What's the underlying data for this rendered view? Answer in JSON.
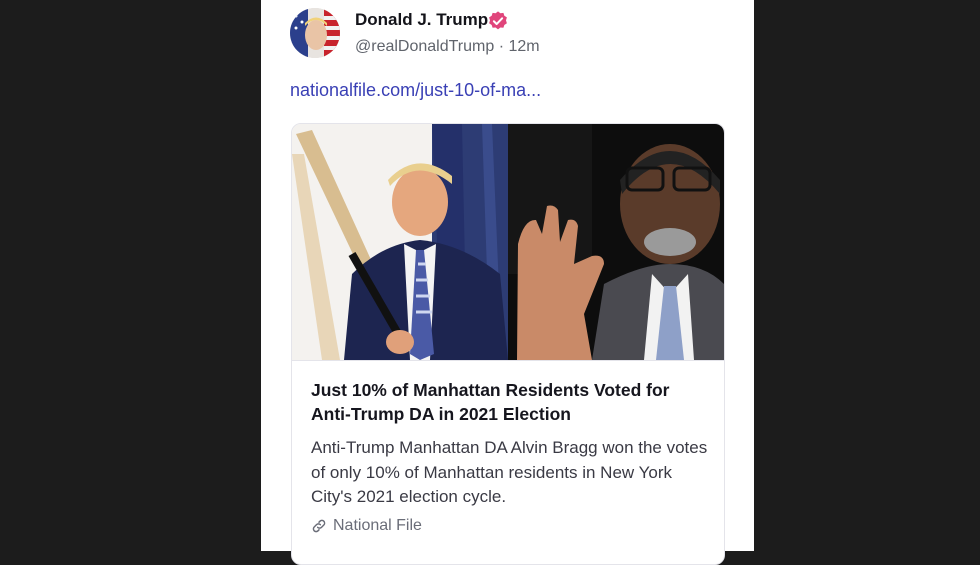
{
  "post": {
    "author_name": "Donald J. Trump",
    "handle": "@realDonaldTrump",
    "separator": "·",
    "time_ago": "12m",
    "link_text": "nationalfile.com/just-10-of-ma..."
  },
  "card": {
    "title": "Just 10% of Manhattan Residents Voted for Anti-Trump DA in 2021 Election",
    "description": "Anti-Trump Manhattan DA Alvin Bragg won the votes of only 10% of Manhattan residents in New York City's 2021 election cycle.",
    "source": "National File"
  },
  "icons": {
    "verified": "verified-badge-icon",
    "source": "link-icon"
  },
  "colors": {
    "link": "#3a40b5",
    "verified_badge": "#e0457b",
    "background": "#1c1c1c"
  }
}
